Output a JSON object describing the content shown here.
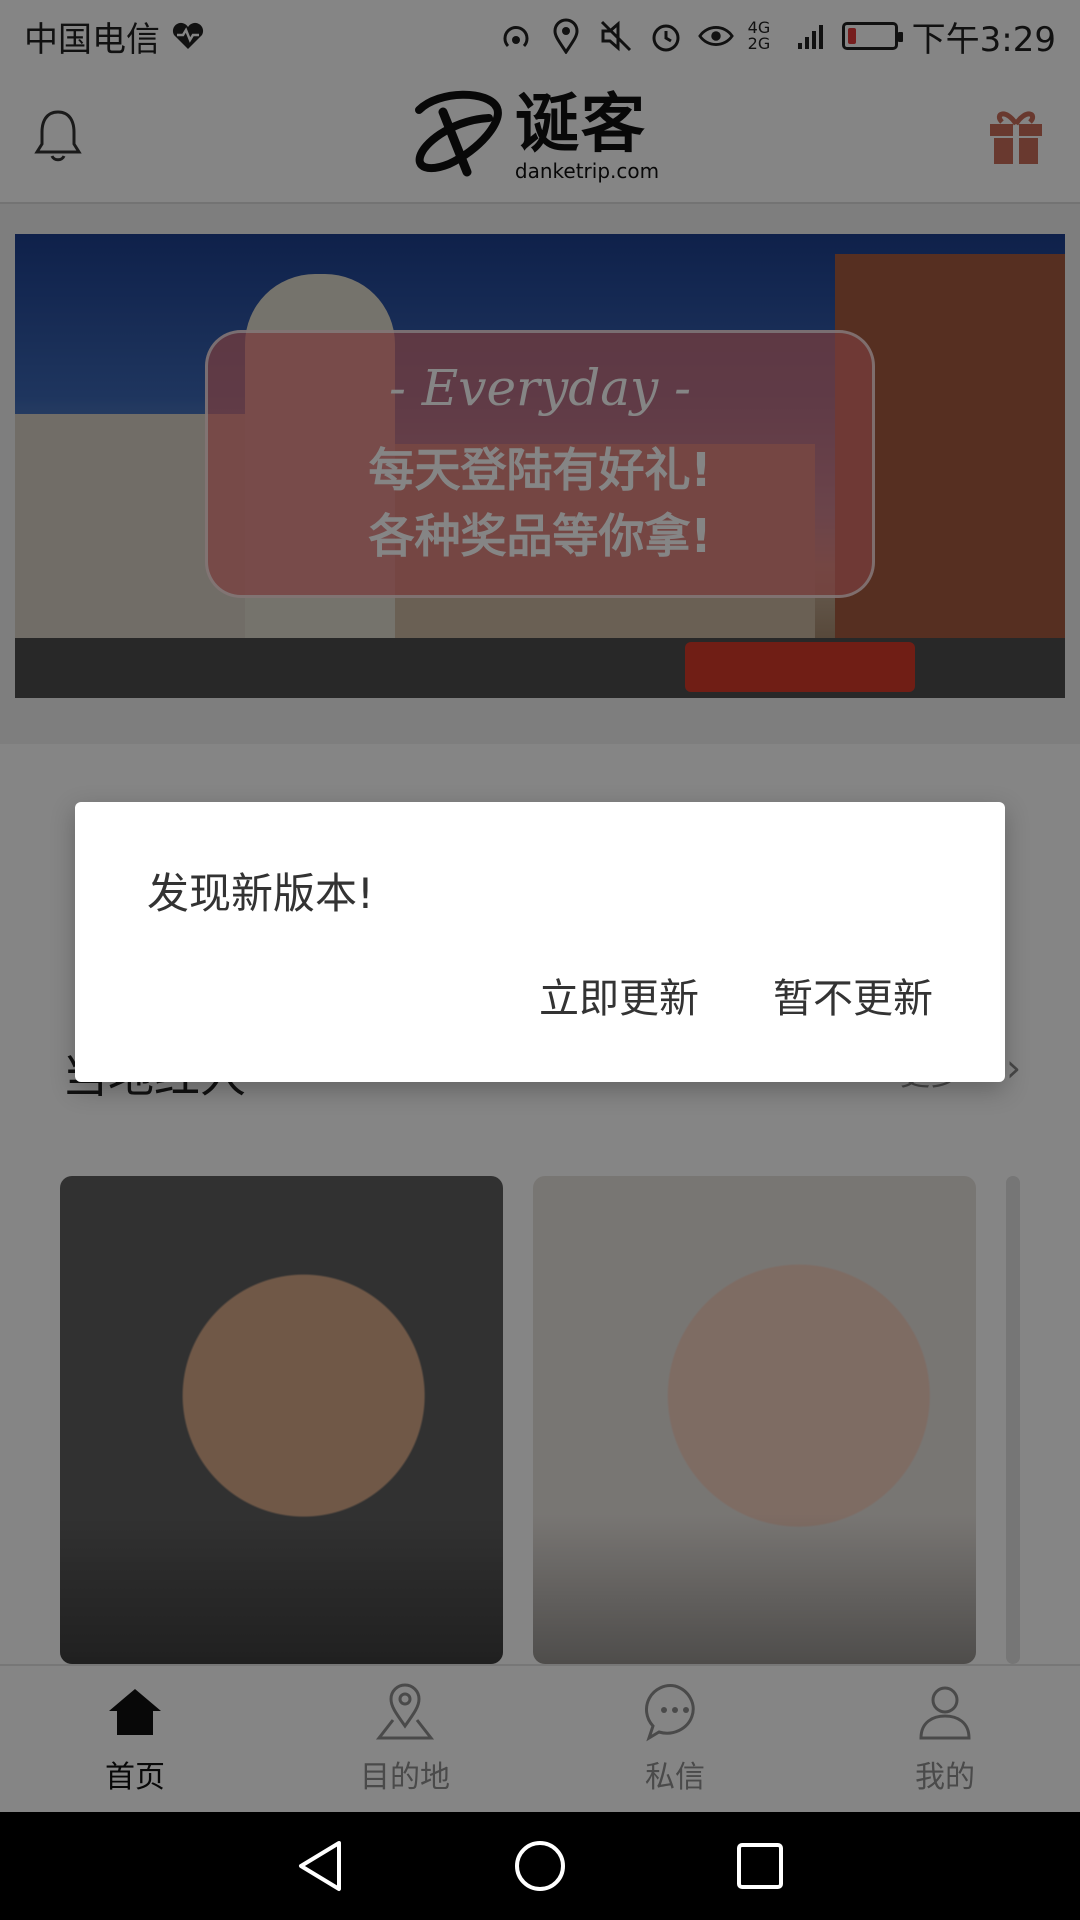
{
  "status_bar": {
    "carrier": "中国电信",
    "time": "下午3:29",
    "network_label": "4G 2G",
    "icons": [
      "heart-pulse-icon",
      "hotspot-icon",
      "location-icon",
      "mute-icon",
      "alarm-icon",
      "eye-icon",
      "signal-icon",
      "battery-icon"
    ]
  },
  "header": {
    "logo_cn": "诞客",
    "logo_en": "danketrip.com",
    "left_icon": "bell-icon",
    "right_icon": "gift-icon"
  },
  "banner": {
    "everyday": "- Everyday -",
    "line1": "每天登陆有好礼!",
    "line2": "各种奖品等你拿!"
  },
  "section": {
    "title": "当地红人",
    "more": "更多"
  },
  "dialog": {
    "title": "发现新版本!",
    "confirm": "立即更新",
    "cancel": "暂不更新"
  },
  "bottom_nav": {
    "items": [
      {
        "label": "首页",
        "icon": "home-icon",
        "active": true
      },
      {
        "label": "目的地",
        "icon": "map-pin-icon",
        "active": false
      },
      {
        "label": "私信",
        "icon": "chat-icon",
        "active": false
      },
      {
        "label": "我的",
        "icon": "user-icon",
        "active": false
      }
    ]
  },
  "colors": {
    "accent_red": "#e47474",
    "dim": "#000000",
    "text": "#333333"
  }
}
